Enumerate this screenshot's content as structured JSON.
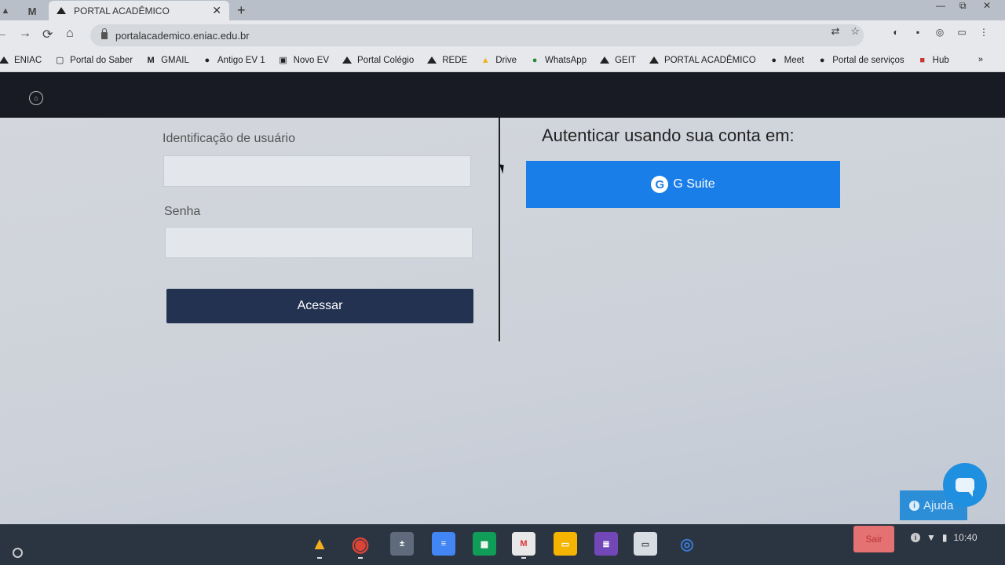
{
  "browser": {
    "pinned_tabs": [
      {
        "icon": "drive-icon"
      },
      {
        "icon": "gmail-icon",
        "glyph": "M"
      }
    ],
    "active_tab": {
      "title": "PORTAL ACADÊMICO",
      "icon": "portal-icon",
      "close": "✕"
    },
    "new_tab": "+",
    "window_controls": {
      "minimize": "—",
      "restore": "⧉",
      "close": "✕"
    },
    "nav": {
      "back": "←",
      "forward": "→",
      "reload": "⟳",
      "home": "⌂"
    },
    "url": "portalacademico.eniac.edu.br",
    "omnibox_icons": {
      "translate": "⇄",
      "bookmark_star": "☆"
    },
    "extension_icons": [
      "◐",
      "▪",
      "◎",
      "▭",
      "⋮"
    ]
  },
  "bookmarks": [
    {
      "label": "ENIAC",
      "icon": "portal-icon"
    },
    {
      "label": "Portal do Saber",
      "icon": "page-icon",
      "glyph": "▢"
    },
    {
      "label": "GMAIL",
      "icon": "gmail-icon",
      "glyph": "M"
    },
    {
      "label": "Antigo EV 1",
      "icon": "globe-icon",
      "glyph": "●"
    },
    {
      "label": "Novo EV",
      "icon": "ev-icon",
      "glyph": "▣"
    },
    {
      "label": "Portal Colégio",
      "icon": "portal-icon"
    },
    {
      "label": "REDE",
      "icon": "portal-icon"
    },
    {
      "label": "Drive",
      "icon": "drive-icon",
      "glyph": "▲"
    },
    {
      "label": "WhatsApp",
      "icon": "whatsapp-icon",
      "glyph": "●"
    },
    {
      "label": "GEIT",
      "icon": "portal-icon"
    },
    {
      "label": "PORTAL ACADÊMICO",
      "icon": "portal-icon"
    },
    {
      "label": "Meet",
      "icon": "meet-icon",
      "glyph": "●"
    },
    {
      "label": "Portal de serviços",
      "icon": "globe-icon",
      "glyph": "●"
    },
    {
      "label": "Hub",
      "icon": "hub-icon",
      "glyph": "■"
    }
  ],
  "bookmarks_more": "»",
  "site_header": {
    "home_icon": "⌂"
  },
  "login": {
    "user_label": "Identificação de usuário",
    "user_value": "",
    "password_label": "Senha",
    "password_value": "",
    "submit_label": "Acessar"
  },
  "sso": {
    "title": "Autenticar usando sua conta em:",
    "gsuite_label": "G Suite",
    "gsuite_glyph": "G"
  },
  "help": {
    "label": "Ajuda",
    "info_glyph": "i"
  },
  "shelf": {
    "apps": [
      {
        "name": "drive",
        "glyph": "▲",
        "color": "#f2b01e"
      },
      {
        "name": "chrome",
        "glyph": "◉",
        "color": "#db4437"
      },
      {
        "name": "calculator",
        "glyph": "±",
        "color": "#5f6b7a"
      },
      {
        "name": "docs",
        "glyph": "≡",
        "color": "#4285f4"
      },
      {
        "name": "sheets",
        "glyph": "▦",
        "color": "#0f9d58"
      },
      {
        "name": "gmail",
        "glyph": "M",
        "color": "#e8e8e8"
      },
      {
        "name": "slides",
        "glyph": "▭",
        "color": "#f4b400"
      },
      {
        "name": "forms",
        "glyph": "≣",
        "color": "#7248b9"
      },
      {
        "name": "chat",
        "glyph": "▭",
        "color": "#d7dde3"
      },
      {
        "name": "screen-recorder",
        "glyph": "◎",
        "color": "#3a7bd5"
      }
    ],
    "sair_label": "Sair",
    "time": "10:40",
    "info_glyph": "i"
  }
}
